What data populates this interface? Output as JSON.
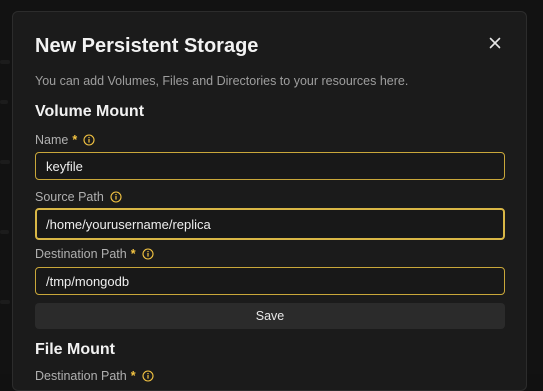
{
  "modal": {
    "title": "New Persistent Storage",
    "description": "You can add Volumes, Files and Directories to your resources here.",
    "close_icon": "close-icon"
  },
  "volume_mount": {
    "heading": "Volume Mount",
    "name": {
      "label": "Name",
      "required_mark": "*",
      "value": "keyfile"
    },
    "source_path": {
      "label": "Source Path",
      "value": "/home/yourusername/replica"
    },
    "destination_path": {
      "label": "Destination Path",
      "required_mark": "*",
      "value": "/tmp/mongodb"
    },
    "save_label": "Save"
  },
  "file_mount": {
    "heading": "File Mount",
    "destination_path": {
      "label": "Destination Path",
      "required_mark": "*"
    }
  },
  "colors": {
    "accent": "#d9b746",
    "background": "#1b1b1b",
    "required": "#f5c542"
  }
}
